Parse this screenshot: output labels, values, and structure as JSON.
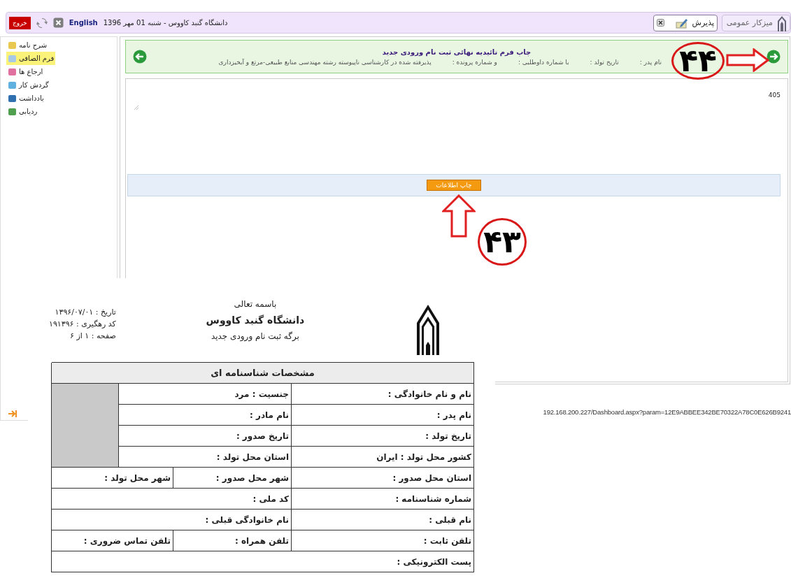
{
  "top_bar": {
    "exit_button": "خروج",
    "language_link": "English",
    "date_text": "دانشگاه گنبد کاووس - شنبه 01 مهر 1396",
    "tabs": [
      {
        "label": "میزکار عمومی",
        "selected": false,
        "closable": false
      },
      {
        "label": "پذیرش",
        "selected": true,
        "closable": true
      }
    ]
  },
  "sidebar": {
    "items": [
      {
        "label": "شرح نامه",
        "selected": false
      },
      {
        "label": "فرم الصاقی",
        "selected": true
      },
      {
        "label": "ارجاع ها",
        "selected": false
      },
      {
        "label": "گردش کار",
        "selected": false
      },
      {
        "label": "یادداشت",
        "selected": false
      },
      {
        "label": "ردیابی",
        "selected": false
      }
    ]
  },
  "form_header": {
    "title": "چاپ فرم تائیدیه نهائی ثبت نام ورودی جدید",
    "fields": [
      "نام پدر :",
      "تاریخ تولد :",
      "با شماره داوطلبی :",
      "و شماره پرونده :",
      "پذیرفته شده در کارشناسی ناپیوسته رشته مهندسی منابع طبیعی-مرتع و آبخیزداری"
    ]
  },
  "content": {
    "counter": "405",
    "print_button": "چاپ اطلاعات"
  },
  "status_url": "192.168.200.227/Dashboard.aspx?param=12E9ABBEE342BE70322A78C0E626B9241",
  "annotations": [
    {
      "number": "۴۴",
      "kind": "right"
    },
    {
      "number": "۴۳",
      "kind": "up"
    }
  ],
  "document": {
    "heading": "باسمه تعالی",
    "university": "دانشگاه گنبد کاووس",
    "form_name": "برگه ثبت نام ورودی جدید",
    "meta": [
      "تاریخ : ۱۳۹۶/۰۷/۰۱",
      "کد رهگیری : ۱۹۱۳۹۶",
      "صفحه : ۱ از ۶"
    ],
    "table": {
      "title": "مشخصات شناسنامه ای",
      "rows": [
        [
          "نام و نام خانوادگی :",
          "جنسیت : مرد"
        ],
        [
          "نام پدر :",
          "نام مادر :"
        ],
        [
          "تاریخ تولد :",
          "تاریخ صدور :"
        ],
        [
          "کشور محل تولد : ایران",
          "استان محل تولد :"
        ],
        [
          "استان محل صدور :",
          "شهر محل صدور :",
          "شهر محل تولد :"
        ],
        [
          "شماره شناسنامه :",
          "کد ملی :"
        ],
        [
          "نام قبلی :",
          "نام خانوادگی قبلی :"
        ],
        [
          "تلفن ثابت :",
          "تلفن همراه :",
          "تلفن تماس ضروری :"
        ],
        [
          "پست الکترونیکی :"
        ]
      ]
    }
  }
}
